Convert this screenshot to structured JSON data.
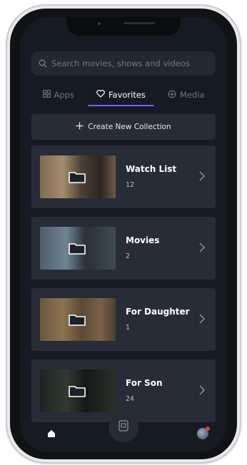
{
  "search": {
    "placeholder": "Search movies, shows and videos",
    "icon": "search-icon"
  },
  "tabs": [
    {
      "label": "Apps",
      "icon": "grid-icon",
      "active": false
    },
    {
      "label": "Favorites",
      "icon": "heart-icon",
      "active": true
    },
    {
      "label": "Media",
      "icon": "media-icon",
      "active": false
    }
  ],
  "create_button": {
    "label": "Create New Collection",
    "icon": "plus-icon"
  },
  "collections": [
    {
      "title": "Watch List",
      "count": "12"
    },
    {
      "title": "Movies",
      "count": "2"
    },
    {
      "title": "For Daughter",
      "count": "1"
    },
    {
      "title": "For Son",
      "count": "24"
    }
  ],
  "bottom_nav": {
    "items": [
      "home-icon",
      "tv-icon",
      "avatar"
    ]
  },
  "colors": {
    "accent": "#7a5cff",
    "background": "#161a22",
    "card": "#272c37"
  }
}
